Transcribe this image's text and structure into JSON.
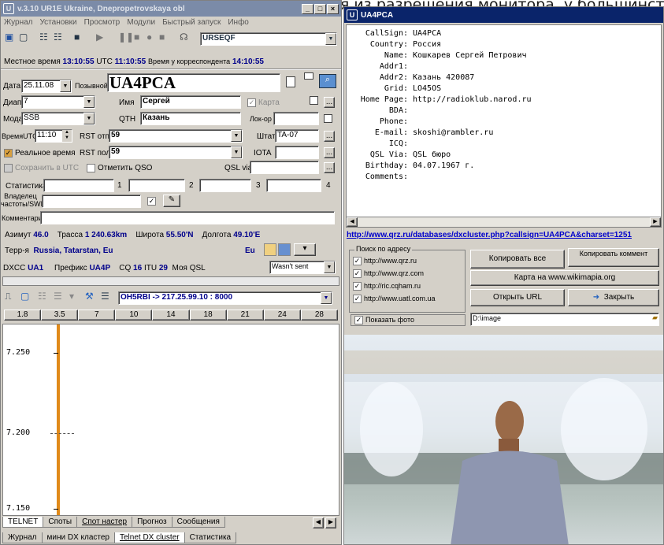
{
  "background_text": "высота, исходя из разрешения монитора, у большинства ко",
  "left": {
    "title": "v.3.10   UR1E Ukraine, Dnepropetrovskaya obl",
    "menu": [
      "Журнал",
      "Установки",
      "Просмотр",
      "Модули",
      "Быстрый запуск",
      "Инфо"
    ],
    "toolbar_combo": "URSEQF",
    "time_line": {
      "local_label": "Местное время",
      "local": "13:10:55",
      "utc_label": "UTC",
      "utc": "11:10:55",
      "corr_label": "Время у корреспондента",
      "corr": "14:10:55"
    },
    "date_label": "Дата",
    "date": "25.11.08",
    "call_label": "Позывной",
    "callsign": "UA4PCA",
    "band_label": "Диап",
    "band": "7",
    "name_label": "Имя",
    "name": "Сергей",
    "map_label": "Карта",
    "mode_label": "Мода",
    "mode": "SSB",
    "qth_label": "QTH",
    "qth": "Казань",
    "loc_label": "Лок-ор",
    "utc_time_label": "ВремяUTC",
    "utc_time": "11:10",
    "rst_sent_label": "RST отп",
    "rst_sent": "59",
    "state_label": "Штат",
    "state": "TA-07",
    "realtime_label": "Реальное время",
    "rst_rcvd_label": "RST пол",
    "rst_rcvd": "59",
    "iota_label": "IOTA",
    "save_utc_label": "Сохранить в UTC",
    "mark_qso_label": "Отметить QSO",
    "qsl_via_label": "QSL via",
    "stats_label": "Статистика",
    "n1": "1",
    "n2": "2",
    "n3": "3",
    "n4": "4",
    "swl_label": "Владелец частоты/SWL",
    "comment_label": "Комментарий",
    "azimuth_label": "Азимут",
    "azimuth": "46.0",
    "route_label": "Трасса",
    "route": "1 240.63km",
    "lat_label": "Широта",
    "lat": "55.50'N",
    "lon_label": "Долгота",
    "lon": "49.10'E",
    "terr_label": "Терр-я",
    "terr": "Russia, Tatarstan, Eu",
    "cont": "Eu",
    "dxcc_label": "DXCC",
    "dxcc": "UA1",
    "prefix_label": "Префикс",
    "prefix": "UA4P",
    "cq_label": "CQ",
    "cq": "16",
    "itu_label": "ITU",
    "itu": "29",
    "myqsl_label": "Моя QSL",
    "myqsl": "Wasn't sent",
    "cluster_combo": "OH5RBI -> 217.25.99.10 : 8000",
    "bands": [
      "1.8",
      "3.5",
      "7",
      "10",
      "14",
      "18",
      "21",
      "24",
      "28"
    ],
    "freq_labels": [
      "7.250",
      "7.200",
      "7.150"
    ],
    "tabs1": [
      "TELNET",
      "Споты",
      "Спот настер",
      "Прогноз",
      "Сообщения"
    ],
    "tabs2": [
      "Журнал",
      "мини DX кластер",
      "Telnet DX cluster",
      "Статистика"
    ]
  },
  "right": {
    "title": "UA4PCA",
    "info_rows": [
      {
        "k": "CallSign:",
        "v": "UA4PCA"
      },
      {
        "k": "Country:",
        "v": "Россия"
      },
      {
        "k": "Name:",
        "v": "Кошкарев Сергей Петрович"
      },
      {
        "k": "Addr1:",
        "v": ""
      },
      {
        "k": "Addr2:",
        "v": "Казань 420087"
      },
      {
        "k": "Grid:",
        "v": "LO45OS"
      },
      {
        "k": "Home Page:",
        "v": "http://radioklub.narod.ru"
      },
      {
        "k": "BDA:",
        "v": ""
      },
      {
        "k": "Phone:",
        "v": ""
      },
      {
        "k": "E-mail:",
        "v": "skoshi@rambler.ru"
      },
      {
        "k": "ICQ:",
        "v": ""
      },
      {
        "k": "QSL Via:",
        "v": "QSL бюро"
      },
      {
        "k": "Birthday:",
        "v": "04.07.1967 г."
      },
      {
        "k": "Comments:",
        "v": ""
      }
    ],
    "url": "http://www.qrz.ru/databases/dxcluster.php?callsign=UA4PCA&charset=1251",
    "search_legend": "Поиск по адресу",
    "sites": [
      "http://www.qrz.ru",
      "http://www.qrz.com",
      "http://ric.cqham.ru",
      "http://www.uatl.com.ua"
    ],
    "copy_all": "Копировать все",
    "copy_comment": "Копировать коммент",
    "map_button": "Карта на www.wikimapia.org",
    "open_url": "Открыть URL",
    "close": "Закрыть",
    "show_photo": "Показать фото",
    "photo_path": "D:\\image"
  },
  "colors": {
    "title_active": "#0a246a",
    "title_inactive": "#7b8ba8",
    "face": "#d4d0c8",
    "blue_text": "#00008b",
    "link": "#0000cc"
  }
}
